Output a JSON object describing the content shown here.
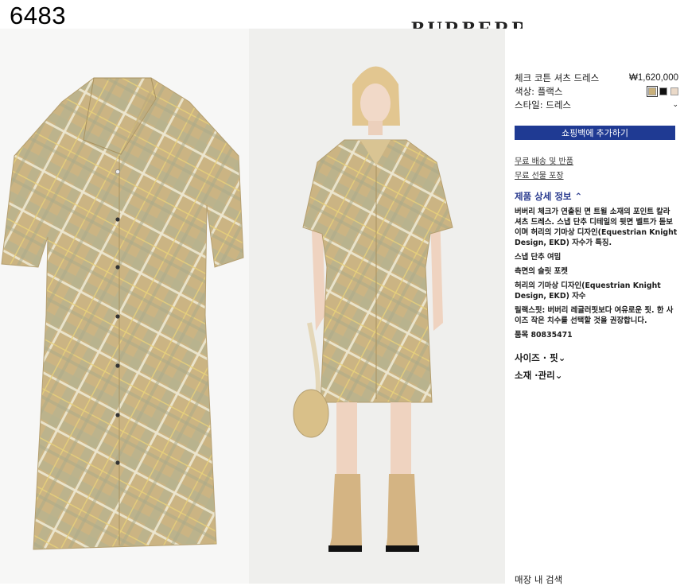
{
  "listing_id": "6483",
  "brand": "BURBERRY",
  "product": {
    "title": "체크 코튼 셔츠 드레스",
    "price": "₩1,620,000",
    "color_label": "색상: 플랙스",
    "style_label": "스타일: 드레스",
    "swatches": [
      {
        "name": "flax",
        "color": "#c9b07a"
      },
      {
        "name": "black",
        "color": "#111111"
      },
      {
        "name": "light",
        "color": "#ead9c8"
      }
    ]
  },
  "actions": {
    "add_to_bag": "쇼핑백에 추가하기",
    "free_shipping": "무료 배송 및 반품",
    "gift_wrap": "무료 선물 포장"
  },
  "details": {
    "heading": "제품 상세 정보",
    "description": "버버리 체크가 연출된 면 트윌 소재의 포인트 칼라 셔츠 드레스. 스냅 단추 디테일의 뒷면 벨트가 돋보이며 허리의 기마상 디자인(Equestrian Knight Design, EKD) 자수가 특징.",
    "bullet_1": "스냅 단추 여밈",
    "bullet_2": "측면의 슬릿 포켓",
    "bullet_3": "허리의 기마상 디자인(Equestrian Knight Design, EKD) 자수",
    "fit_note": "릴랙스핏: 버버리 레귤러핏보다 여유로운 핏. 한 사이즈 작은 치수를 선택할 것을 권장합니다.",
    "item_number": "품목 80835471"
  },
  "accordions": {
    "size_fit": "사이즈 · 핏",
    "material_care": "소재 ·관리"
  },
  "store_search": "매장 내 검색",
  "colors": {
    "button_blue": "#1f3a93",
    "details_blue": "#2a3b8f",
    "check_base": "#c9b382"
  }
}
